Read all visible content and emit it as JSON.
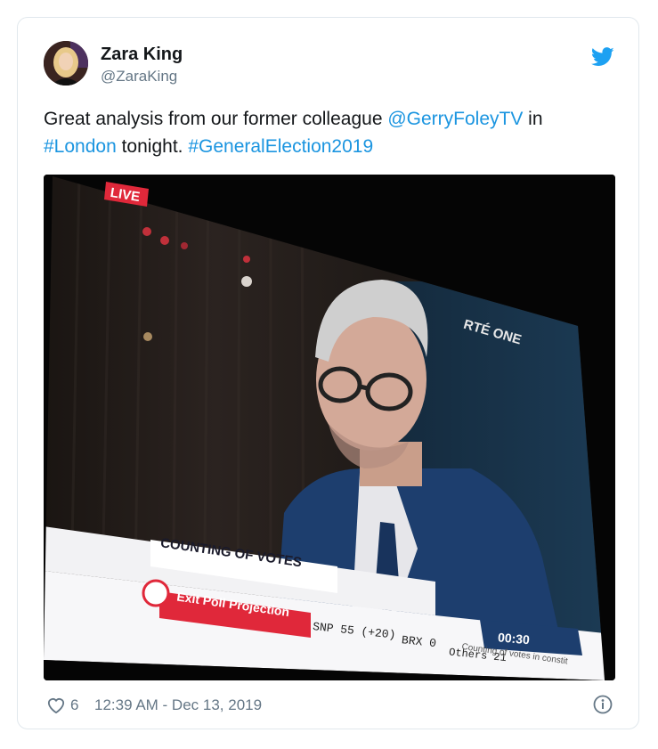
{
  "tweet": {
    "author_name": "Zara King",
    "author_handle": "@ZaraKing",
    "text_part1": "Great analysis from our former colleague ",
    "mention": "@GerryFoleyTV",
    "text_part2": " in ",
    "hashtag1": "#London",
    "text_part3": " tonight. ",
    "hashtag2": "#GeneralElection2019",
    "like_count": "6",
    "timestamp": "12:39 AM - Dec 13, 2019"
  },
  "photo": {
    "live_badge": "LIVE",
    "channel_logo": "RTÉ ONE",
    "lower_third": "COUNTING OF VOTES",
    "exit_poll_label": "Exit Poll Projection",
    "ticker_snp": "SNP 55 (+20)",
    "ticker_brx": "BRX 0",
    "ticker_others": "Others 21",
    "clock": "00:30",
    "sub_ticker": "Counting of votes in constit"
  },
  "icons": {
    "brand": "twitter-bird-icon",
    "like": "heart-icon",
    "info": "info-icon"
  },
  "colors": {
    "link": "#1b95e0",
    "twitter_blue": "#1da1f2",
    "muted": "#657786",
    "border": "#e1e8ed"
  }
}
